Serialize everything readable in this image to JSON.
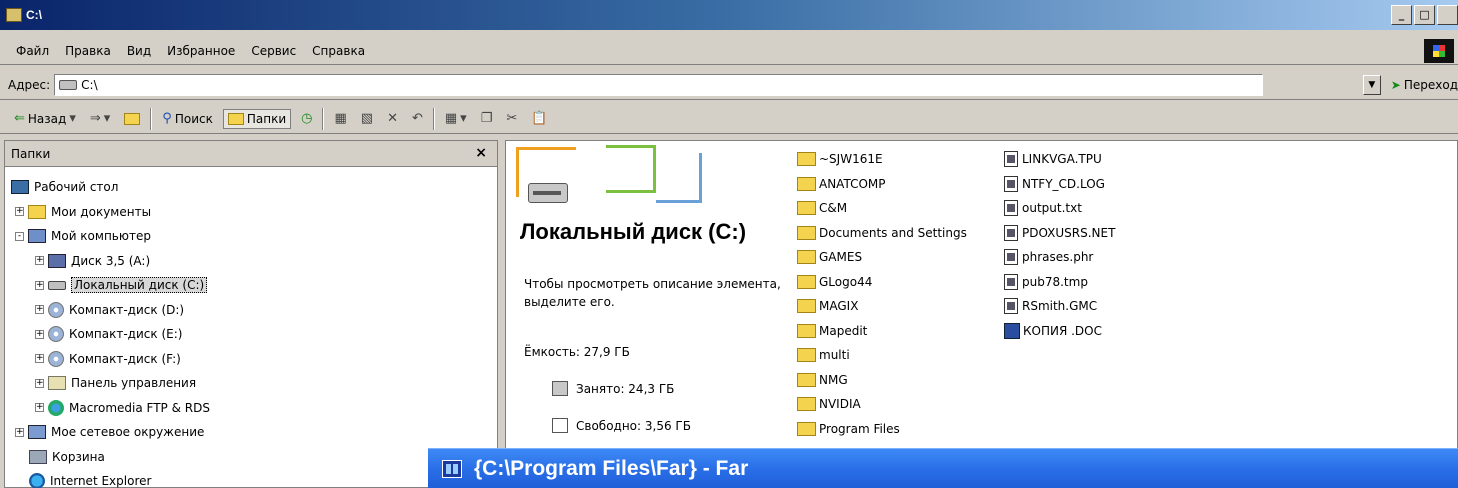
{
  "window": {
    "title": "C:\\",
    "controls": [
      "_",
      "×",
      ""
    ]
  },
  "menubar": {
    "items": [
      "Файл",
      "Правка",
      "Вид",
      "Избранное",
      "Сервис",
      "Справка"
    ]
  },
  "address": {
    "label": "Адрес:",
    "value": "C:\\",
    "go_label": "Переход"
  },
  "toolbar": {
    "back_label": "Назад",
    "search_label": "Поиск",
    "folders_label": "Папки"
  },
  "folders_panel": {
    "title": "Папки",
    "close": "×",
    "tree": [
      {
        "label": "Рабочий стол",
        "icon": "desktop-icon"
      },
      {
        "label": "Мои документы",
        "icon": "my-documents-icon"
      },
      {
        "label": "Мой компьютер",
        "icon": "my-computer-icon"
      },
      {
        "label": "Диск 3,5 (A:)",
        "icon": "floppy-icon"
      },
      {
        "label": "Локальный диск (C:)",
        "icon": "hard-drive-icon"
      },
      {
        "label": "Компакт-диск (D:)",
        "icon": "cd-drive-icon"
      },
      {
        "label": "Компакт-диск (E:)",
        "icon": "cd-drive-icon"
      },
      {
        "label": "Компакт-диск (F:)",
        "icon": "cd-drive-icon"
      },
      {
        "label": "Панель управления",
        "icon": "control-panel-icon"
      },
      {
        "label": "Macromedia FTP & RDS",
        "icon": "ftp-globe-icon"
      },
      {
        "label": "Мое сетевое окружение",
        "icon": "network-places-icon"
      },
      {
        "label": "Корзина",
        "icon": "recycle-bin-icon"
      },
      {
        "label": "Internet Explorer",
        "icon": "internet-explorer-icon"
      }
    ]
  },
  "disk_info": {
    "title": "Локальный диск (C:)",
    "description": "Чтобы просмотреть описание элемента, выделите его.",
    "capacity": "Ёмкость: 27,9 ГБ",
    "used": "Занято: 24,3 ГБ",
    "free": "Свободно: 3,56 ГБ"
  },
  "files_col1": [
    "~SJW161E",
    "ANATCOMP",
    "C&M",
    "Documents and Settings",
    "GAMES",
    "GLogo44",
    "MAGIX",
    "Mapedit",
    "multi",
    "NMG",
    "NVIDIA",
    "Program Files"
  ],
  "files_col2": [
    "LINKVGA.TPU",
    "NTFY_CD.LOG",
    "output.txt",
    "PDOXUSRS.NET",
    "phrases.phr",
    "pub78.tmp",
    "RSmith.GMC",
    "КОПИЯ .DOC"
  ],
  "far_window": {
    "title": "{C:\\Program Files\\Far} - Far"
  }
}
